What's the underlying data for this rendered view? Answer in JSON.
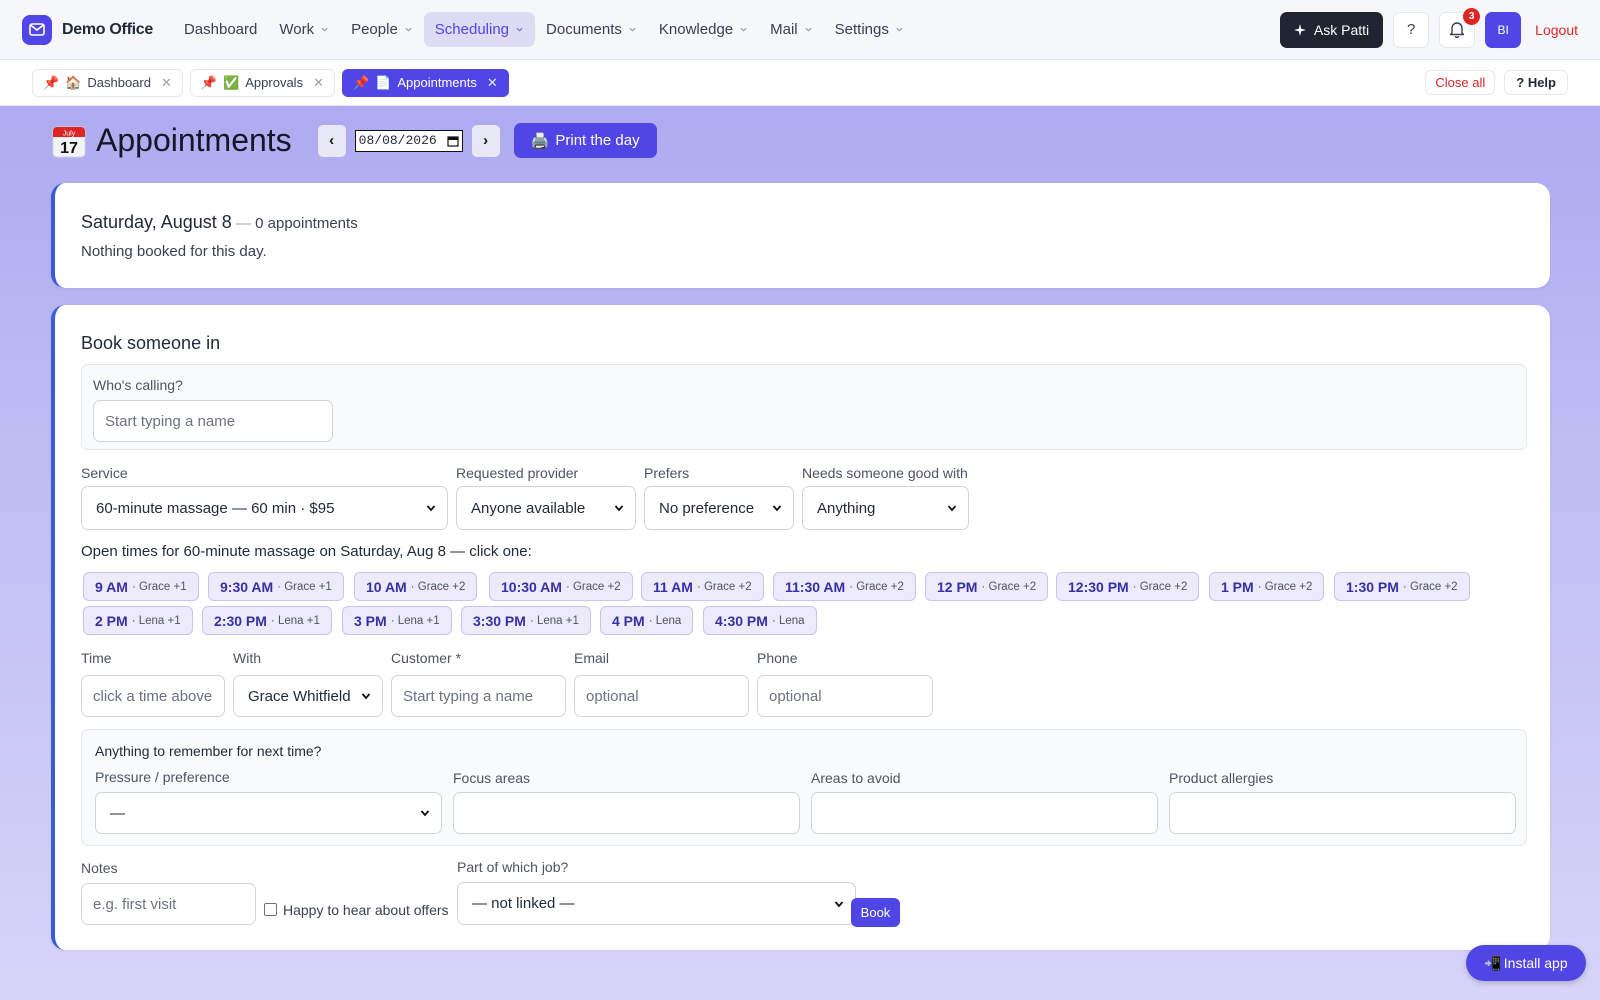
{
  "brand": {
    "name": "Demo Office"
  },
  "nav": {
    "items": [
      {
        "label": "Dashboard"
      },
      {
        "label": "Work"
      },
      {
        "label": "People"
      },
      {
        "label": "Scheduling"
      },
      {
        "label": "Documents"
      },
      {
        "label": "Knowledge"
      },
      {
        "label": "Mail"
      },
      {
        "label": "Settings"
      }
    ],
    "active": "Scheduling",
    "ask_label": "Ask Patti",
    "help_icon": "?",
    "notif_count": "3",
    "avatar_initials": "BI",
    "logout_label": "Logout"
  },
  "tabs": {
    "items": [
      {
        "emoji": "🏠",
        "label": "Dashboard"
      },
      {
        "emoji": "✅",
        "label": "Approvals"
      },
      {
        "emoji": "📄",
        "label": "Appointments"
      }
    ],
    "close_all": "Close all",
    "help": "? Help"
  },
  "page": {
    "title": "Appointments",
    "prev": "‹",
    "next": "›",
    "date_value": "08/08/2026",
    "print_label": "Print the day",
    "print_emoji": "🖨️",
    "calendar_month": "July",
    "calendar_day": "17"
  },
  "day": {
    "title": "Saturday, August 8",
    "dash": " — ",
    "count": "0 appointments",
    "empty": "Nothing booked for this day."
  },
  "booking": {
    "title": "Book someone in",
    "who_label": "Who's calling?",
    "who_placeholder": "Start typing a name",
    "service_label": "Service",
    "service_value": "60-minute massage — 60 min · $95",
    "provider_label": "Requested provider",
    "provider_value": "Anyone available",
    "prefers_label": "Prefers",
    "prefers_value": "No preference",
    "needs_label": "Needs someone good with",
    "needs_value": "Anything",
    "open_times_text": "Open times for 60-minute massage on Saturday, Aug 8 — click one:",
    "slots": [
      {
        "time": "9 AM",
        "who": "· Grace +1"
      },
      {
        "time": "9:30 AM",
        "who": "· Grace +1"
      },
      {
        "time": "10 AM",
        "who": "· Grace +2"
      },
      {
        "time": "10:30 AM",
        "who": "· Grace +2"
      },
      {
        "time": "11 AM",
        "who": "· Grace +2"
      },
      {
        "time": "11:30 AM",
        "who": "· Grace +2"
      },
      {
        "time": "12 PM",
        "who": "· Grace +2"
      },
      {
        "time": "12:30 PM",
        "who": "· Grace +2"
      },
      {
        "time": "1 PM",
        "who": "· Grace +2"
      },
      {
        "time": "1:30 PM",
        "who": "· Grace +2"
      },
      {
        "time": "2 PM",
        "who": "· Lena +1"
      },
      {
        "time": "2:30 PM",
        "who": "· Lena +1"
      },
      {
        "time": "3 PM",
        "who": "· Lena +1"
      },
      {
        "time": "3:30 PM",
        "who": "· Lena +1"
      },
      {
        "time": "4 PM",
        "who": "· Lena"
      },
      {
        "time": "4:30 PM",
        "who": "· Lena"
      }
    ],
    "time_label": "Time",
    "time_placeholder": "click a time above",
    "with_label": "With",
    "with_value": "Grace Whitfield",
    "customer_label": "Customer *",
    "customer_placeholder": "Start typing a name",
    "email_label": "Email",
    "email_placeholder": "optional",
    "phone_label": "Phone",
    "phone_placeholder": "optional",
    "remember_title": "Anything to remember for next time?",
    "pressure_label": "Pressure / preference",
    "pressure_value": "—",
    "focus_label": "Focus areas",
    "avoid_label": "Areas to avoid",
    "allergies_label": "Product allergies",
    "notes_label": "Notes",
    "notes_placeholder": "e.g. first visit",
    "offers_label": "Happy to hear about offers",
    "job_label": "Part of which job?",
    "job_value": "— not linked —",
    "book_label": "Book"
  },
  "install": {
    "label": "Install app",
    "emoji": "📲"
  },
  "colors": {
    "accent": "#4f46e5",
    "card_border": "#3b5bdb",
    "danger": "#dc2626"
  }
}
